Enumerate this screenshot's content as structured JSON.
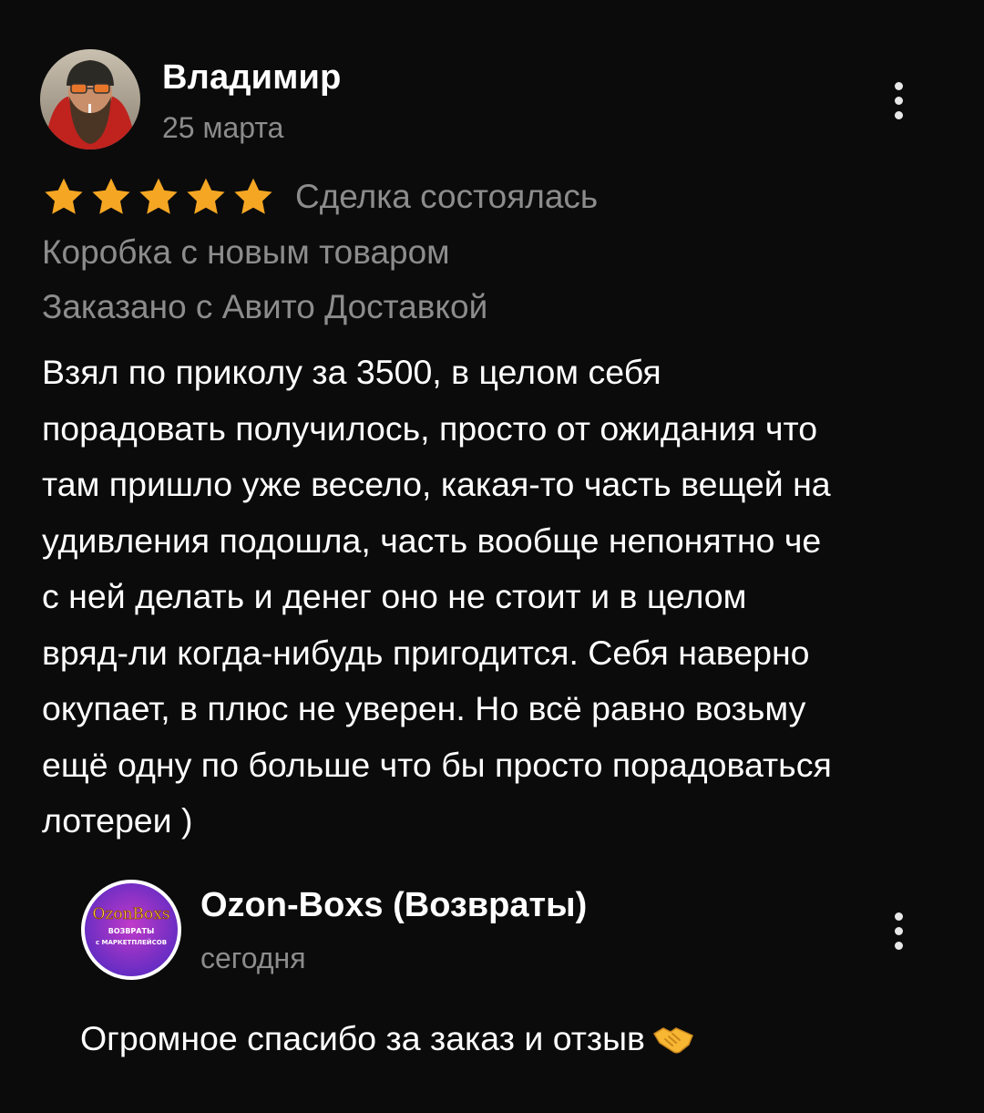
{
  "review": {
    "author": {
      "name": "Владимир",
      "date": "25 марта",
      "avatar_icon": "user-photo-avatar"
    },
    "rating": {
      "stars": 5,
      "max": 5,
      "star_color": "#f5a623"
    },
    "deal_status": "Сделка состоялась",
    "item_title": "Коробка с новым товаром",
    "delivery": "Заказано с Авито Доставкой",
    "text": "Взял по приколу за 3500, в целом себя\nпорадовать получилось, просто от ожидания что\nтам пришло уже весело, какая-то часть вещей на\nудивления подошла, часть вообще непонятно че\nс ней делать и денег оно не стоит и в целом\nвряд-ли когда-нибудь пригодится. Себя наверно\nокупает, в плюс не уверен. Но всё равно возьму\nещё одну по больше что бы просто порадоваться\nлотереи )",
    "more_icon": "more-vertical-icon"
  },
  "reply": {
    "seller_name": "Ozon-Boxs (Возвраты)",
    "date": "сегодня",
    "text": "Огромное спасибо за заказ и отзыв",
    "emoji_icon": "handshake-icon",
    "logo": {
      "title": "OzonBoxs",
      "line1": "ВОЗВРАТЫ",
      "line2": "с МАРКЕТПЛЕЙСОВ"
    },
    "more_icon": "more-vertical-icon"
  },
  "colors": {
    "background": "#0b0b0b",
    "primary_text": "#ffffff",
    "secondary_text": "#8c8c8c",
    "star": "#f5a623",
    "logo_gradient_start": "#7b3fe4",
    "logo_gradient_end": "#c13ac9"
  }
}
